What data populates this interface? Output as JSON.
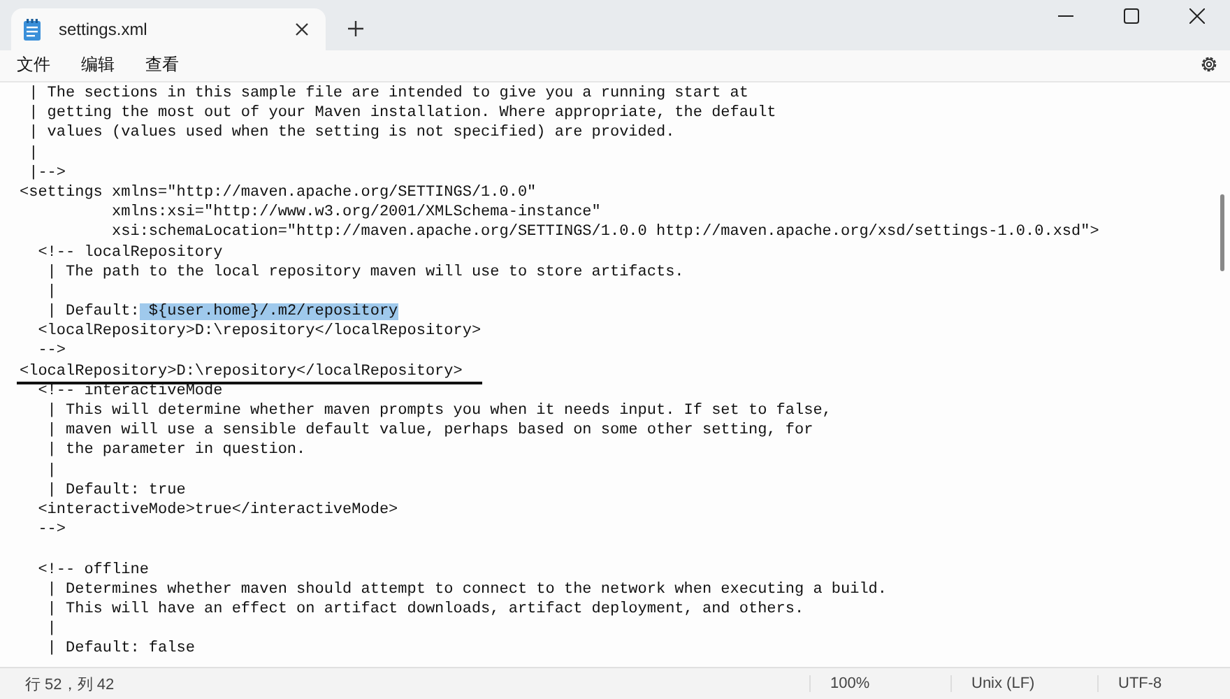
{
  "tab": {
    "title": "settings.xml",
    "selected": true
  },
  "menu": [
    "文件",
    "编辑",
    "查看"
  ],
  "lines": [
    {
      "kind": "code",
      "text": " | The sections in this sample file are intended to give you a running start at"
    },
    {
      "kind": "code",
      "text": " | getting the most out of your Maven installation. Where appropriate, the default"
    },
    {
      "kind": "code",
      "text": " | values (values used when the setting is not specified) are provided."
    },
    {
      "kind": "code",
      "text": " |"
    },
    {
      "kind": "code",
      "text": " |-->"
    },
    {
      "kind": "code",
      "text": "<settings xmlns=\"http://maven.apache.org/SETTINGS/1.0.0\""
    },
    {
      "kind": "code",
      "text": "          xmlns:xsi=\"http://www.w3.org/2001/XMLSchema-instance\""
    },
    {
      "kind": "code",
      "text": "          xsi:schemaLocation=\"http://maven.apache.org/SETTINGS/1.0.0 http://maven.apache.org/xsd/settings-1.0.0.xsd\">"
    },
    {
      "kind": "code",
      "text": "  <!-- localRepository"
    },
    {
      "kind": "code",
      "text": "   | The path to the local repository maven will use to store artifacts."
    },
    {
      "kind": "code",
      "text": "   |"
    },
    {
      "kind": "code",
      "text": "   | Default:",
      "selection": " ${user.home}/.m2/repository"
    },
    {
      "kind": "code",
      "text": "  <localRepository>D:\\repository</localRepository>"
    },
    {
      "kind": "code",
      "text": "  -->"
    },
    {
      "kind": "marked",
      "text": "<localRepository>D:\\repository</localRepository>"
    },
    {
      "kind": "code",
      "text": "  <!-- interactiveMode"
    },
    {
      "kind": "code",
      "text": "   | This will determine whether maven prompts you when it needs input. If set to false,"
    },
    {
      "kind": "code",
      "text": "   | maven will use a sensible default value, perhaps based on some other setting, for"
    },
    {
      "kind": "code",
      "text": "   | the parameter in question."
    },
    {
      "kind": "code",
      "text": "   |"
    },
    {
      "kind": "code",
      "text": "   | Default: true"
    },
    {
      "kind": "code",
      "text": "  <interactiveMode>true</interactiveMode>"
    },
    {
      "kind": "code",
      "text": "  -->"
    },
    {
      "kind": "blank"
    },
    {
      "kind": "code",
      "text": "  <!-- offline"
    },
    {
      "kind": "code",
      "text": "   | Determines whether maven should attempt to connect to the network when executing a build."
    },
    {
      "kind": "code",
      "text": "   | This will have an effect on artifact downloads, artifact deployment, and others."
    },
    {
      "kind": "code",
      "text": "   |"
    },
    {
      "kind": "code",
      "text": "   | Default: false"
    }
  ],
  "status_bar": {
    "position": "行 52，列 42",
    "zoom": "100%",
    "line_ending": "Unix (LF)",
    "encoding": "UTF-8"
  }
}
